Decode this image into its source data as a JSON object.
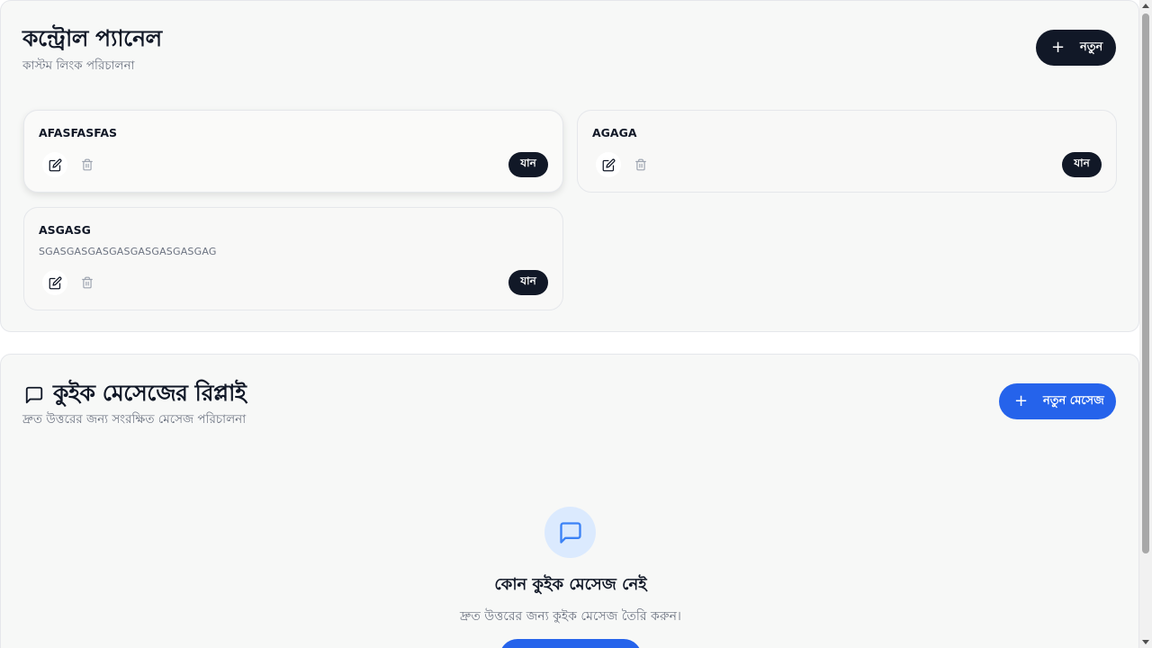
{
  "control_panel": {
    "title": "কন্ট্রোল প্যানেল",
    "subtitle": "কাস্টম লিংক পরিচালনা",
    "new_button_label": "নতুন",
    "links": [
      {
        "title": "AFASFASFAS",
        "description": "",
        "go_label": "যান"
      },
      {
        "title": "AGAGA",
        "description": "",
        "go_label": "যান"
      },
      {
        "title": "ASGASG",
        "description": "SGASGASGASGASGASGASGASGAG",
        "go_label": "যান"
      }
    ]
  },
  "quick_messages": {
    "title": "কুইক মেসেজের রিপ্লাই",
    "subtitle": "দ্রুত উত্তরের জন্য সংরক্ষিত মেসেজ পরিচালনা",
    "new_button_label": "নতুন মেসেজ",
    "empty_title": "কোন কুইক মেসেজ নেই",
    "empty_description": "দ্রুত উত্তরের জন্য কুইক মেসেজ তৈরি করুন।"
  },
  "icons": {
    "plus": "plus-icon",
    "edit": "edit-icon",
    "delete": "trash-icon",
    "message": "message-square-icon"
  },
  "colors": {
    "primary_dark": "#111827",
    "accent_blue": "#2563eb",
    "icon_bg_blue": "#dbeafe",
    "panel_bg": "#f7f8f7"
  }
}
